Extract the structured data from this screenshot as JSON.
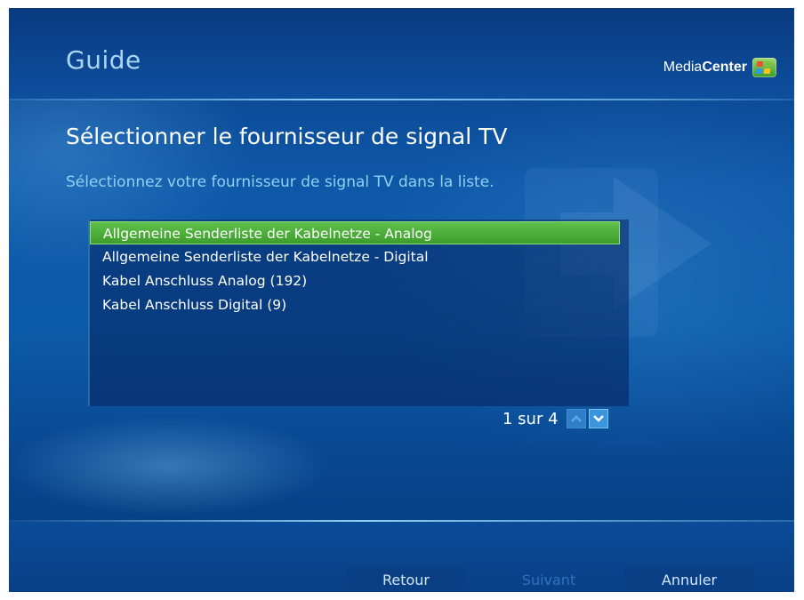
{
  "header": {
    "title": "Guide",
    "brand_light": "Media",
    "brand_bold": "Center",
    "logo_icon": "windows-flag-icon"
  },
  "page": {
    "title": "Sélectionner le fournisseur de signal TV",
    "subtitle": "Sélectionnez votre fournisseur de signal TV dans la liste."
  },
  "provider_list": {
    "items": [
      {
        "label": "Allgemeine Senderliste der Kabelnetze - Analog",
        "selected": true
      },
      {
        "label": "Allgemeine Senderliste der Kabelnetze - Digital",
        "selected": false
      },
      {
        "label": "Kabel Anschluss Analog (192)",
        "selected": false
      },
      {
        "label": "Kabel Anschluss Digital (9)",
        "selected": false
      }
    ]
  },
  "pager": {
    "text": "1 sur 4",
    "up_icon": "chevron-up-icon",
    "down_icon": "chevron-down-icon"
  },
  "footer": {
    "back_label": "Retour",
    "next_label": "Suivant",
    "cancel_label": "Annuler"
  },
  "colors": {
    "selection": "#4caf3a",
    "background": "#0c5ba8",
    "subtitle": "#8fd0f5",
    "header_title": "#a9d6f2"
  }
}
